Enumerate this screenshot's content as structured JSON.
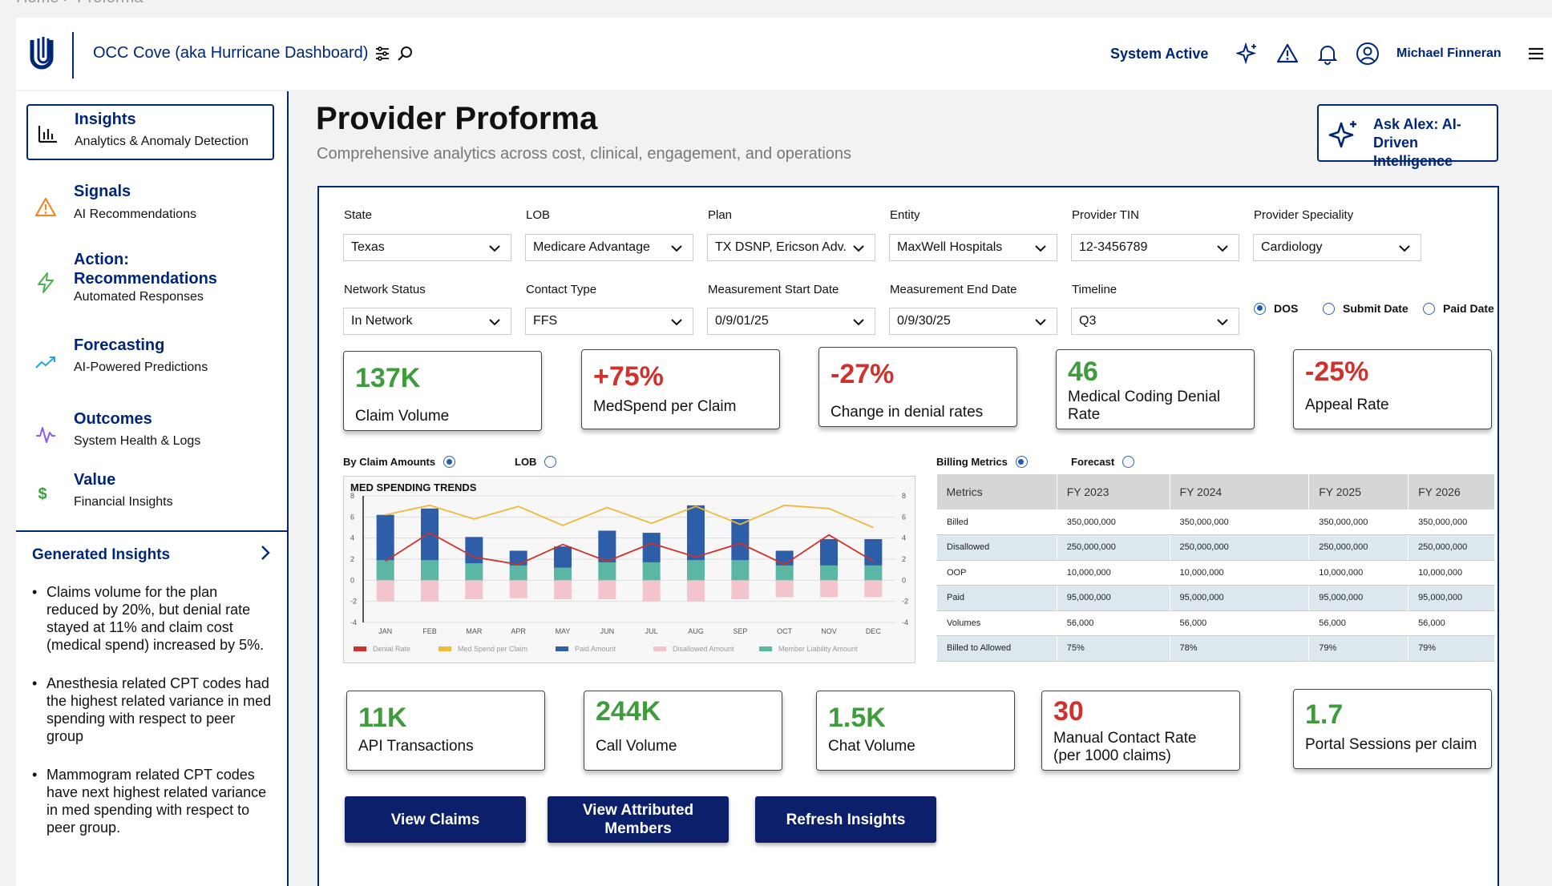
{
  "breadcrumb": "Home > Proforma",
  "header": {
    "app_title": "OCC Cove (aka Hurricane Dashboard)",
    "status": "System Active",
    "user_name": "Michael Finneran"
  },
  "sidebar": {
    "items": [
      {
        "title": "Insights",
        "subtitle": "Analytics & Anomaly Detection",
        "icon": "bar-chart-icon"
      },
      {
        "title": "Signals",
        "subtitle": "AI Recommendations",
        "icon": "warning-icon"
      },
      {
        "title": "Action: Recommendations",
        "subtitle": "Automated Responses",
        "icon": "lightning-icon"
      },
      {
        "title": "Forecasting",
        "subtitle": "AI-Powered Predictions",
        "icon": "trend-up-icon"
      },
      {
        "title": "Outcomes",
        "subtitle": "System Health & Logs",
        "icon": "pulse-icon"
      },
      {
        "title": "Value",
        "subtitle": "Financial Insights",
        "icon": "dollar-icon"
      }
    ],
    "generated_insights_title": "Generated Insights",
    "insights": [
      "Claims volume for the plan reduced by 20%, but denial rate stayed at 11% and claim cost (medical spend) increased by 5%.",
      "Anesthesia related CPT codes had the highest related variance in med spending with respect to peer group",
      "Mammogram related CPT codes have next highest related variance in med spending with respect to peer group."
    ]
  },
  "main": {
    "title": "Provider Proforma",
    "subtitle": "Comprehensive analytics across cost, clinical, engagement, and operations",
    "ask_button": "Ask Alex: AI-Driven Intelligence"
  },
  "filters": {
    "state": {
      "label": "State",
      "value": "Texas"
    },
    "lob": {
      "label": "LOB",
      "value": "Medicare Advantage"
    },
    "plan": {
      "label": "Plan",
      "value": "TX DSNP, Ericson Adv."
    },
    "entity": {
      "label": "Entity",
      "value": "MaxWell Hospitals"
    },
    "tin": {
      "label": "Provider TIN",
      "value": "12-3456789"
    },
    "speciality": {
      "label": "Provider Speciality",
      "value": "Cardiology"
    },
    "network": {
      "label": "Network Status",
      "value": "In Network"
    },
    "contact": {
      "label": "Contact Type",
      "value": "FFS"
    },
    "start": {
      "label": "Measurement Start Date",
      "value": "0/9/01/25"
    },
    "end": {
      "label": "Measurement End Date",
      "value": "0/9/30/25"
    },
    "timeline": {
      "label": "Timeline",
      "value": "Q3"
    },
    "date_type": {
      "options": [
        "DOS",
        "Submit Date",
        "Paid Date"
      ],
      "selected": "DOS"
    }
  },
  "kpis_top": [
    {
      "value": "137K",
      "label": "Claim Volume",
      "color": "#3e9c3c"
    },
    {
      "value": "+75%",
      "label": "MedSpend per Claim",
      "color": "#d0312d"
    },
    {
      "value": "-27%",
      "label": "Change in denial rates",
      "color": "#d0312d"
    },
    {
      "value": "46",
      "label": "Medical Coding Denial Rate",
      "color": "#3e9c3c"
    },
    {
      "value": "-25%",
      "label": "Appeal Rate",
      "color": "#d0312d"
    }
  ],
  "chart_toggle": {
    "options": [
      "By Claim Amounts",
      "LOB"
    ],
    "selected": "By Claim Amounts"
  },
  "table_toggle": {
    "options": [
      "Billing Metrics",
      "Forecast"
    ],
    "selected": "Billing Metrics"
  },
  "chart_data": {
    "type": "bar",
    "title": "MED SPENDING TRENDS",
    "categories": [
      "JAN",
      "FEB",
      "MAR",
      "APR",
      "MAY",
      "JUN",
      "JUL",
      "AUG",
      "SEP",
      "OCT",
      "NOV",
      "DEC"
    ],
    "ylim": [
      -4,
      8
    ],
    "yticks": [
      8,
      6,
      4,
      2,
      0,
      -2,
      -4
    ],
    "series": [
      {
        "name": "Paid Amount",
        "kind": "bar",
        "color": "#2f5ea8",
        "values": [
          4.3,
          4.9,
          2.5,
          1.4,
          2,
          3,
          2.8,
          5.2,
          3.9,
          1.4,
          2.5,
          2.5
        ]
      },
      {
        "name": "Member Liability Amount",
        "kind": "bar",
        "color": "#5bb7a3",
        "values": [
          1.9,
          1.9,
          1.6,
          1.4,
          1.2,
          1.7,
          1.7,
          1.9,
          1.9,
          1.4,
          1.4,
          1.4
        ]
      },
      {
        "name": "Disallowed Amount",
        "kind": "bar",
        "color": "#f3c4cc",
        "values": [
          -2,
          -2,
          -1.8,
          -1.7,
          -1.8,
          -1.8,
          -2,
          -2,
          -1.8,
          -1.6,
          -1.6,
          -1.6
        ]
      },
      {
        "name": "Denial Rate",
        "kind": "line",
        "color": "#d0312d",
        "values": [
          1.8,
          4.5,
          2.2,
          1.5,
          3.4,
          1.8,
          3.5,
          2.2,
          3.5,
          1.5,
          4.3,
          1.8
        ]
      },
      {
        "name": "Med Spend per Claim",
        "kind": "line",
        "color": "#f0b93a",
        "values": [
          6.2,
          7.1,
          5.8,
          7,
          5.2,
          6.9,
          5.4,
          7,
          5.3,
          7.1,
          6.8,
          5
        ]
      }
    ]
  },
  "billing_table": {
    "headers": [
      "Metrics",
      "FY 2023",
      "FY 2024",
      "FY 2025",
      "FY 2026"
    ],
    "rows": [
      [
        "Billed",
        "350,000,000",
        "350,000,000",
        "350,000,000",
        "350,000,000"
      ],
      [
        "Disallowed",
        "250,000,000",
        "250,000,000",
        "250,000,000",
        "250,000,000"
      ],
      [
        "OOP",
        "10,000,000",
        "10,000,000",
        "10,000,000",
        "10,000,000"
      ],
      [
        "Paid",
        "95,000,000",
        "95,000,000",
        "95,000,000",
        "95,000,000"
      ],
      [
        "Volumes",
        "56,000",
        "56,000",
        "56,000",
        "56,000"
      ],
      [
        "Billed to Allowed",
        "75%",
        "78%",
        "79%",
        "79%"
      ]
    ]
  },
  "kpis_bottom": [
    {
      "value": "11K",
      "label": "API Transactions",
      "color": "#3e9c3c"
    },
    {
      "value": "244K",
      "label": "Call Volume",
      "color": "#3e9c3c"
    },
    {
      "value": "1.5K",
      "label": "Chat Volume",
      "color": "#3e9c3c"
    },
    {
      "value": "30",
      "label": "Manual Contact Rate (per 1000 claims)",
      "color": "#d0312d"
    },
    {
      "value": "1.7",
      "label": "Portal Sessions per claim",
      "color": "#3e9c3c"
    }
  ],
  "actions": [
    "View Claims",
    "View Attributed Members",
    "Refresh Insights"
  ],
  "colors": {
    "brand": "#002677",
    "button": "#0b1f6b",
    "positive": "#3e9c3c",
    "negative": "#d0312d"
  }
}
